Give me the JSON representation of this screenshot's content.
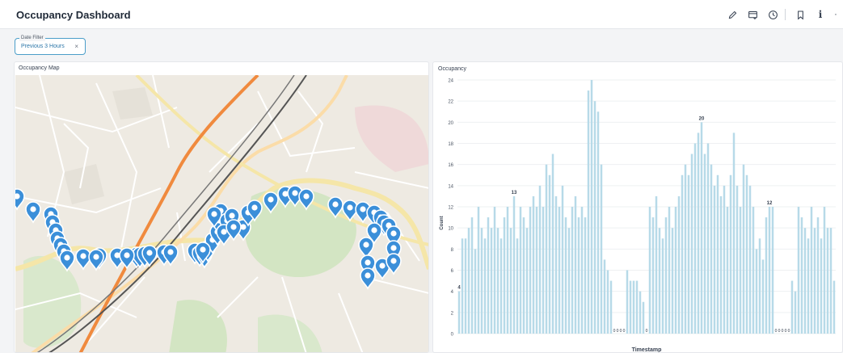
{
  "header": {
    "title": "Occupancy Dashboard",
    "actions": [
      {
        "name": "edit-icon"
      },
      {
        "name": "dashboard-icon"
      },
      {
        "name": "clock-icon"
      },
      {
        "name": "bookmark-icon"
      },
      {
        "name": "info-icon",
        "glyph": "i"
      },
      {
        "name": "more-icon",
        "glyph": "·"
      }
    ]
  },
  "filter": {
    "legend": "Date Filter",
    "value": "Previous 3 Hours",
    "clear": "×"
  },
  "map_card": {
    "title": "Occupancy Map",
    "marker_count": 56,
    "marker_color": "#3b8fd9"
  },
  "chart_card": {
    "title": "Occupancy"
  },
  "chart_data": {
    "type": "bar",
    "title": "",
    "xlabel": "Timestamp",
    "ylabel": "Count",
    "ylim": [
      0,
      24
    ],
    "yticks": [
      0,
      2,
      4,
      6,
      8,
      10,
      12,
      14,
      16,
      18,
      20,
      22,
      24
    ],
    "bar_color": "#b7dae8",
    "grid": true,
    "values": [
      4,
      9,
      9,
      10,
      11,
      8,
      12,
      10,
      9,
      11,
      10,
      12,
      10,
      9,
      11,
      12,
      10,
      13,
      9,
      12,
      11,
      10,
      12,
      13,
      12,
      14,
      12,
      16,
      15,
      17,
      13,
      12,
      14,
      11,
      10,
      12,
      13,
      11,
      12,
      11,
      23,
      24,
      22,
      21,
      16,
      7,
      6,
      5,
      0,
      0,
      0,
      0,
      6,
      5,
      5,
      5,
      4,
      3,
      0,
      12,
      11,
      13,
      10,
      9,
      11,
      12,
      10,
      12,
      13,
      15,
      16,
      15,
      17,
      18,
      19,
      20,
      17,
      18,
      16,
      14,
      15,
      13,
      14,
      12,
      15,
      19,
      14,
      12,
      16,
      15,
      14,
      12,
      8,
      9,
      7,
      11,
      12,
      12,
      0,
      0,
      0,
      0,
      0,
      5,
      4,
      12,
      11,
      10,
      9,
      12,
      10,
      11,
      9,
      12,
      10,
      10,
      5
    ],
    "point_labels": [
      {
        "index": 0,
        "text": "4"
      },
      {
        "index": 17,
        "text": "13"
      },
      {
        "index": 75,
        "text": "20"
      },
      {
        "index": 96,
        "text": "12"
      }
    ],
    "zero_label": "0"
  }
}
